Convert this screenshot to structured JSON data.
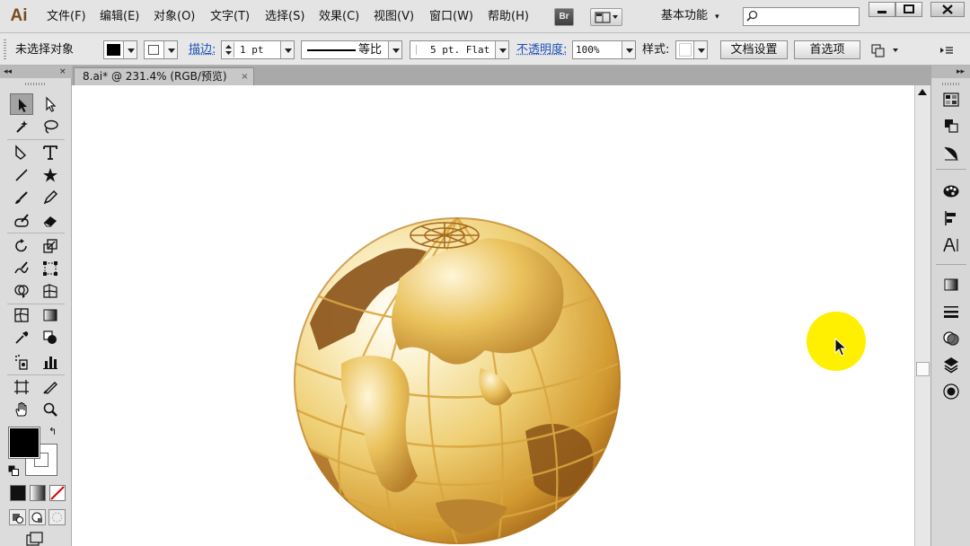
{
  "app": {
    "logo": "Ai",
    "menus": [
      "文件(F)",
      "编辑(E)",
      "对象(O)",
      "文字(T)",
      "选择(S)",
      "效果(C)",
      "视图(V)",
      "窗口(W)",
      "帮助(H)"
    ],
    "bridge_label": "Br",
    "workspace_label": "基本功能",
    "search_placeholder": ""
  },
  "control_bar": {
    "selection_status": "未选择对象",
    "stroke_label": "描边:",
    "stroke_weight": "1 pt",
    "profile_label": "等比",
    "brush_label": "5 pt. Flat",
    "opacity_label": "不透明度:",
    "opacity_value": "100%",
    "style_label": "样式:",
    "doc_setup_label": "文档设置",
    "preferences_label": "首选项"
  },
  "document": {
    "tab_label": "8.ai* @ 231.4% (RGB/预览)",
    "close_glyph": "×"
  },
  "colors": {
    "accent_link": "#1f4fb8",
    "cursor_highlight": "#ffef00",
    "globe_gold": "#d8a63a",
    "globe_bronze": "#8a5218"
  },
  "tools": [
    "selection-tool",
    "direct-selection-tool",
    "magic-wand-tool",
    "lasso-tool",
    "pen-tool",
    "type-tool",
    "line-segment-tool",
    "star-tool",
    "paintbrush-tool",
    "pencil-tool",
    "blob-brush-tool",
    "eraser-tool",
    "rotate-tool",
    "scale-tool",
    "warp-tool",
    "free-transform-tool",
    "shape-builder-tool",
    "perspective-grid-tool",
    "mesh-tool",
    "gradient-tool",
    "eyedropper-tool",
    "blend-tool",
    "symbol-sprayer-tool",
    "column-graph-tool",
    "artboard-tool",
    "slice-tool",
    "hand-tool",
    "zoom-tool"
  ],
  "right_dock_panels": [
    "swatches-panel",
    "arrange-panel",
    "transform-panel",
    "color-guide-panel",
    "align-panel",
    "character-panel",
    "gradient-panel",
    "stroke-panel",
    "transparency-panel",
    "layers-panel",
    "appearance-panel"
  ]
}
